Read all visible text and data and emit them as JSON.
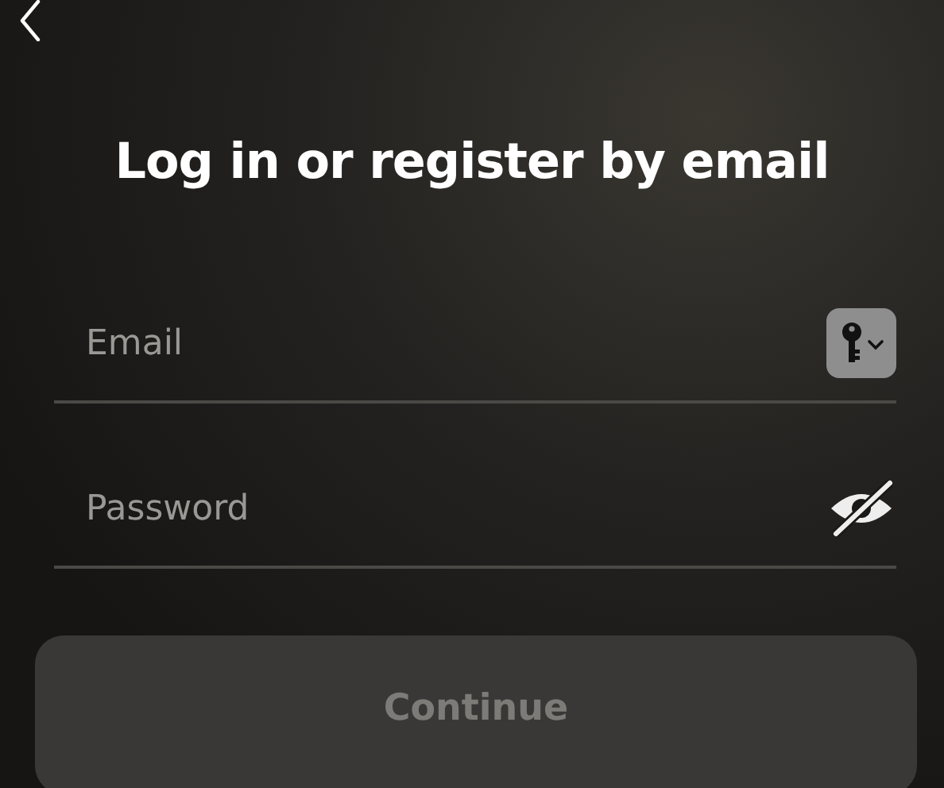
{
  "title": "Log in or register by email",
  "fields": [
    {
      "kind": "email",
      "placeholder": "Email"
    },
    {
      "kind": "password",
      "placeholder": "Password"
    }
  ],
  "continue_button": {
    "label": "Continue",
    "disabled": true
  }
}
